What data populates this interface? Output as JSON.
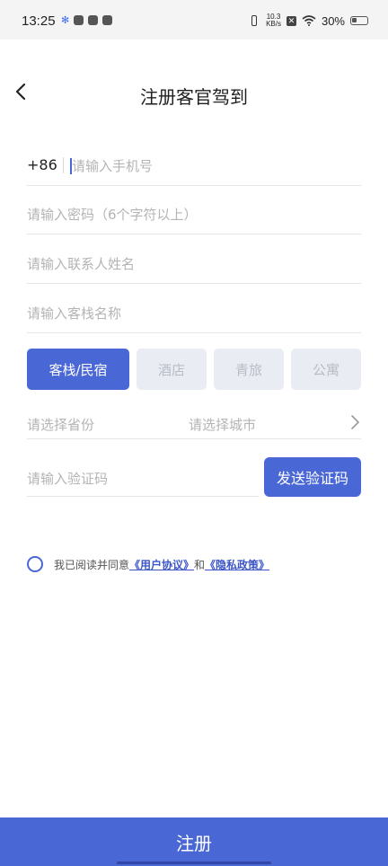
{
  "status_bar": {
    "time": "13:25",
    "speed_top": "10.3",
    "speed_unit": "KB/s",
    "battery": "30%",
    "battery_level": 0.3
  },
  "header": {
    "title": "注册客官驾到",
    "back_icon": "back-arrow-icon"
  },
  "form": {
    "country_code": "+86",
    "phone_placeholder": "请输入手机号",
    "password_placeholder": "请输入密码（6个字符以上）",
    "contact_placeholder": "请输入联系人姓名",
    "inn_placeholder": "请输入客栈名称",
    "types": [
      {
        "label": "客栈/民宿",
        "selected": true
      },
      {
        "label": "酒店",
        "selected": false
      },
      {
        "label": "青旅",
        "selected": false
      },
      {
        "label": "公寓",
        "selected": false
      }
    ],
    "province_placeholder": "请选择省份",
    "city_placeholder": "请选择城市",
    "code_placeholder": "请输入验证码",
    "send_code_label": "发送验证码"
  },
  "agreement": {
    "prefix": "我已阅读并同意",
    "user_agreement": "《用户协议》",
    "and": "和",
    "privacy_policy": "《隐私政策》"
  },
  "register_label": "注册",
  "colors": {
    "accent": "#4a67d6",
    "inactive_button": "#e9ecf2",
    "placeholder": "#b4b4b4"
  }
}
